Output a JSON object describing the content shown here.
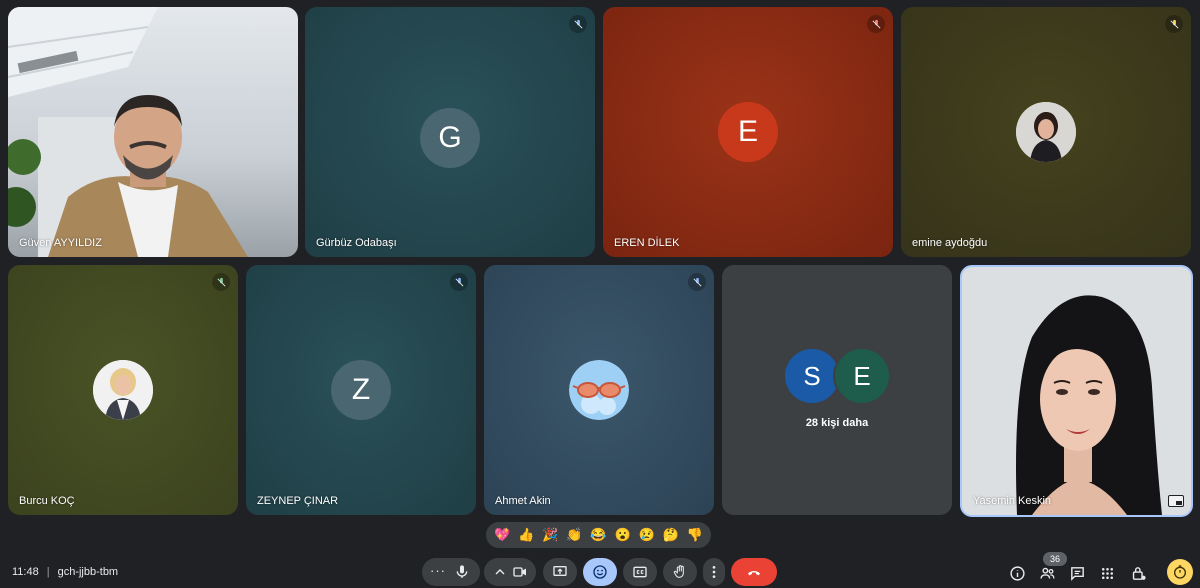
{
  "participants": {
    "p1": {
      "name": "Güven AYYILDIZ"
    },
    "p2": {
      "name": "Gürbüz Odabaşı",
      "initial": "G"
    },
    "p3": {
      "name": "EREN DİLEK",
      "initial": "E"
    },
    "p4": {
      "name": "emine aydoğdu"
    },
    "p5": {
      "name": "Burcu KOÇ"
    },
    "p6": {
      "name": "ZEYNEP ÇINAR",
      "initial": "Z"
    },
    "p7": {
      "name": "Ahmet Akin"
    },
    "p8": {
      "initials": [
        "S",
        "E"
      ],
      "more_label": "28 kişi daha"
    },
    "p9": {
      "name": "Yasemin Keskin"
    }
  },
  "reactions": [
    "💖",
    "👍",
    "🎉",
    "👏",
    "😂",
    "😮",
    "😢",
    "🤔",
    "👎"
  ],
  "footer": {
    "time": "11:48",
    "separator": "|",
    "meeting_code": "gch-jjbb-tbm",
    "people_count": "36"
  },
  "icons": [
    "mic-off-icon",
    "more-options-icon",
    "mic-icon",
    "chevron-up-icon",
    "camera-icon",
    "present-icon",
    "emoji-icon",
    "captions-icon",
    "raise-hand-icon",
    "more-vert-icon",
    "end-call-icon",
    "info-icon",
    "people-icon",
    "chat-icon",
    "activities-icon",
    "host-controls-icon",
    "timer-icon"
  ],
  "colors": {
    "background": "#202124",
    "tile_teal": "#234a52",
    "tile_red": "#8a2a14",
    "tile_olive": "#3e3d1b",
    "tile_green_olive": "#434c22",
    "tile_grey": "#3c4043",
    "end_call": "#ea4335",
    "active_button": "#a8c7fa"
  }
}
